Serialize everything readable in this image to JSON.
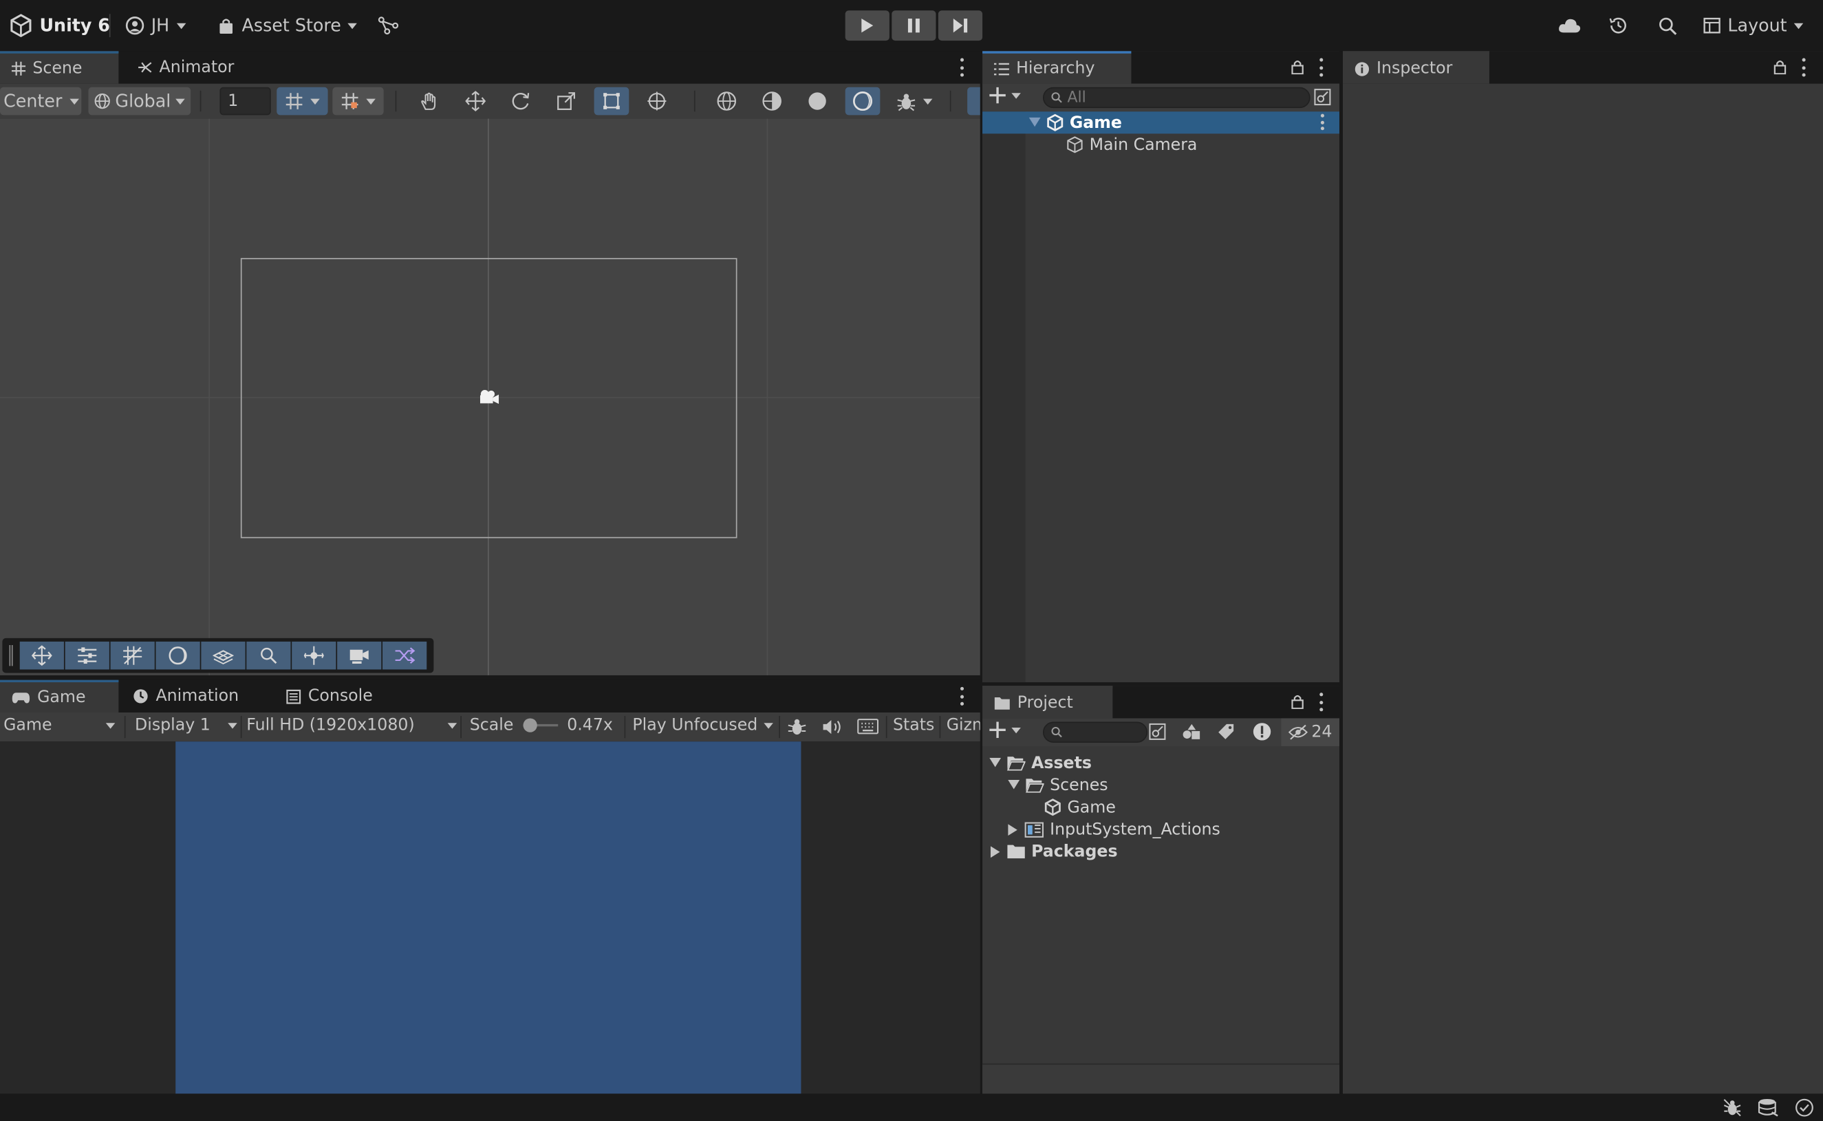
{
  "app": {
    "brand": "Unity 6",
    "account": "JH",
    "asset_store": "Asset Store",
    "layout": "Layout"
  },
  "scene_panel": {
    "tabs": [
      "Scene",
      "Animator"
    ],
    "pivot": "Center",
    "space": "Global",
    "grid_value": "1"
  },
  "game_panel": {
    "tabs": [
      "Game",
      "Animation",
      "Console"
    ],
    "view": "Game",
    "display": "Display 1",
    "resolution": "Full HD (1920x1080)",
    "scale_label": "Scale",
    "scale_value": "0.47x",
    "play_mode": "Play Unfocused",
    "stats": "Stats",
    "gizmos": "Gizm",
    "game_bg": "#31517d"
  },
  "hierarchy": {
    "tab": "Hierarchy",
    "search_placeholder": "All",
    "items": [
      {
        "label": "Game",
        "selected": true
      },
      {
        "label": "Main Camera"
      }
    ]
  },
  "inspector": {
    "tab": "Inspector"
  },
  "project": {
    "tab": "Project",
    "hidden_count": "24",
    "items": [
      {
        "label": "Assets"
      },
      {
        "label": "Scenes"
      },
      {
        "label": "Game"
      },
      {
        "label": "InputSystem_Actions"
      },
      {
        "label": "Packages"
      }
    ]
  },
  "colors": {
    "selection": "#2c5d87",
    "panel": "#383838",
    "chrome": "#191919",
    "accent": "#46607c"
  }
}
